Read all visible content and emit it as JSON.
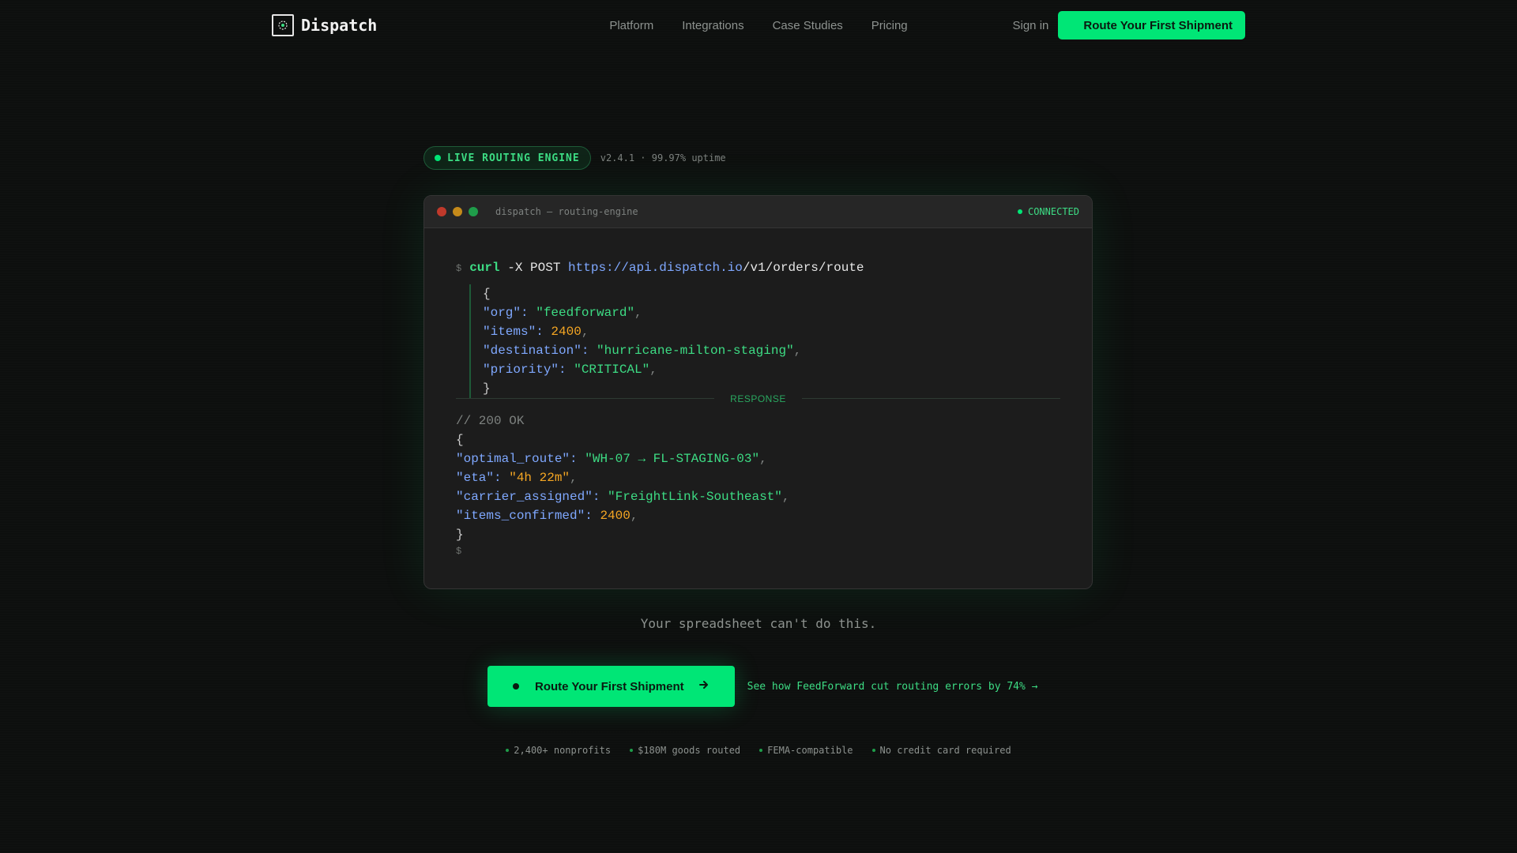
{
  "nav": {
    "brand": "Dispatch",
    "links": [
      "Platform",
      "Integrations",
      "Case Studies",
      "Pricing"
    ],
    "signin": "Sign in",
    "cta": "Route Your First Shipment"
  },
  "status": {
    "badge": "LIVE ROUTING ENGINE",
    "version": "v2.4.1 · 99.97% uptime"
  },
  "terminal": {
    "title": "dispatch — routing-engine",
    "connection": "CONNECTED",
    "prompt": "$",
    "command": {
      "name": "curl",
      "flags": "-X POST",
      "url_host": "https://api.dispatch.io",
      "url_path": "/v1/orders/route"
    },
    "request": [
      {
        "key": "\"org\"",
        "value": "\"feedforward\"",
        "type": "str"
      },
      {
        "key": "\"items\"",
        "value": "2400",
        "type": "num"
      },
      {
        "key": "\"destination\"",
        "value": "\"hurricane-milton-staging\"",
        "type": "str"
      },
      {
        "key": "\"priority\"",
        "value": "\"CRITICAL\"",
        "type": "str"
      }
    ],
    "divider": "RESPONSE",
    "status_comment": "// 200 OK",
    "response": [
      {
        "key": "\"optimal_route\"",
        "value": "\"WH-07 → FL-STAGING-03\"",
        "type": "str"
      },
      {
        "key": "\"eta\"",
        "value": "\"4h 22m\"",
        "type": "num"
      },
      {
        "key": "\"carrier_assigned\"",
        "value": "\"FreightLink-Southeast\"",
        "type": "str"
      },
      {
        "key": "\"items_confirmed\"",
        "value": "2400",
        "type": "num"
      }
    ]
  },
  "tagline": "Your spreadsheet can't do this.",
  "cta": {
    "button": "Route Your First Shipment",
    "link": "See how FeedForward cut routing errors by 74% →"
  },
  "proof": [
    "2,400+ nonprofits",
    "$180M goods routed",
    "FEMA-compatible",
    "No credit card required"
  ],
  "colors": {
    "accent": "#00e676",
    "background": "#0d0f0e",
    "terminal": "#1c1c1c"
  }
}
